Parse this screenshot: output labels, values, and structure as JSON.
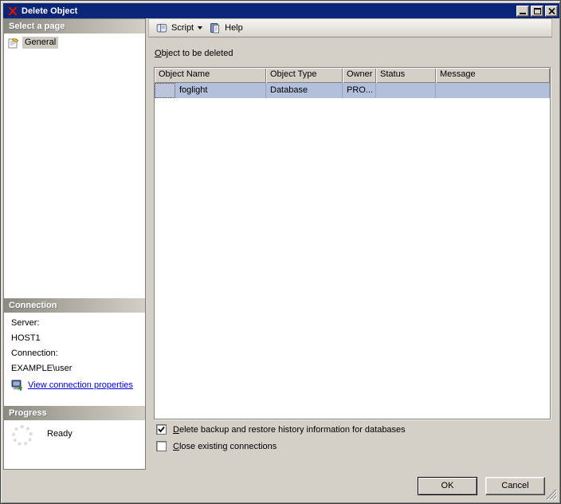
{
  "window": {
    "title": "Delete Object"
  },
  "sidebar": {
    "select_page_header": "Select a page",
    "pages": [
      {
        "label": "General"
      }
    ],
    "connection": {
      "header": "Connection",
      "server_label": "Server:",
      "server_value": "HOST1",
      "connection_label": "Connection:",
      "connection_value": "EXAMPLE\\user",
      "view_link_label": "View connection properties"
    },
    "progress": {
      "header": "Progress",
      "status": "Ready"
    }
  },
  "toolbar": {
    "script_label": "Script",
    "help_label": "Help"
  },
  "main": {
    "section_label": {
      "first": "O",
      "rest": "bject to be deleted"
    },
    "table": {
      "columns": [
        "Object Name",
        "Object Type",
        "Owner",
        "Status",
        "Message"
      ],
      "rows": [
        {
          "object_name": "foglight",
          "object_type": "Database",
          "owner": "PRO...",
          "status": "",
          "message": ""
        }
      ]
    },
    "options": [
      {
        "first": "D",
        "rest": "elete backup and restore history information for databases",
        "checked": true
      },
      {
        "first": "C",
        "rest": "lose existing connections",
        "checked": false
      }
    ]
  },
  "footer": {
    "ok_label": "OK",
    "cancel_label": "Cancel"
  },
  "colors": {
    "titlebar": "#0b2578",
    "selected_row": "#b3c0dc",
    "link": "#0000ee"
  }
}
